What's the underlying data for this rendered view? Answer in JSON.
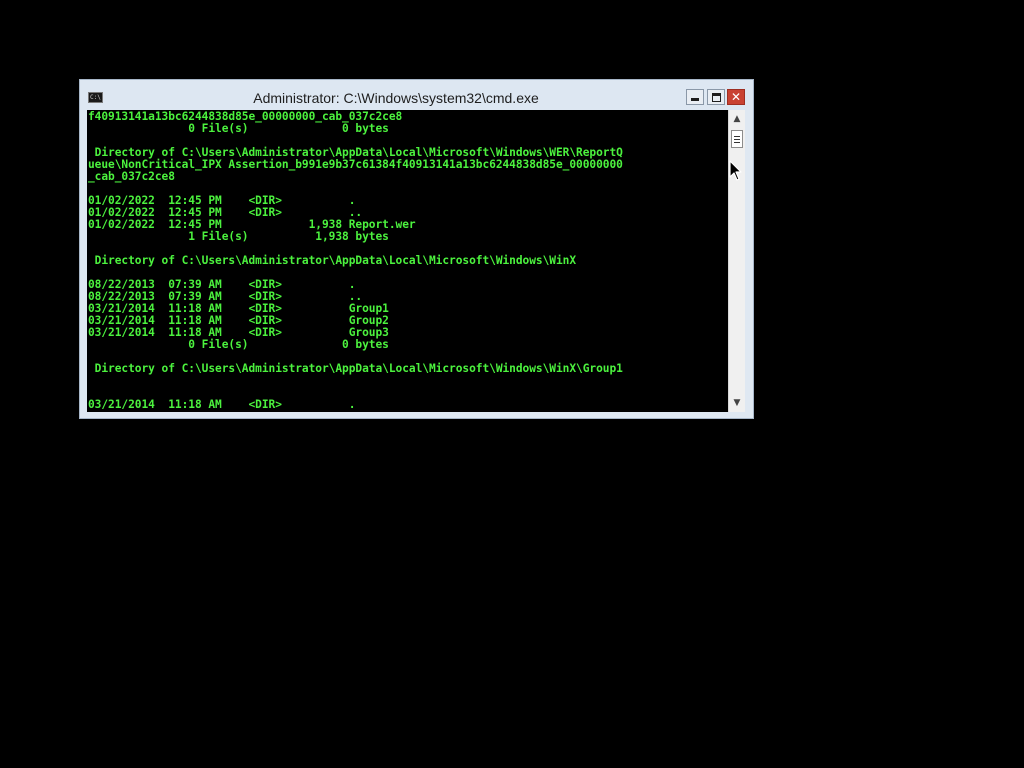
{
  "window": {
    "title": "Administrator: C:\\Windows\\system32\\cmd.exe",
    "icon": "cmd-console-icon",
    "icon_text": "C:\\.",
    "minimize_icon": "minimize-icon",
    "maximize_icon": "maximize-icon",
    "close_icon": "close-icon",
    "close_glyph": "✕"
  },
  "console": {
    "text_color": "#4cf23e",
    "background": "#000000",
    "lines": [
      "f40913141a13bc6244838d85e_00000000_cab_037c2ce8",
      "               0 File(s)              0 bytes",
      "",
      " Directory of C:\\Users\\Administrator\\AppData\\Local\\Microsoft\\Windows\\WER\\ReportQ",
      "ueue\\NonCritical_IPX Assertion_b991e9b37c61384f40913141a13bc6244838d85e_00000000",
      "_cab_037c2ce8",
      "",
      "01/02/2022  12:45 PM    <DIR>          .",
      "01/02/2022  12:45 PM    <DIR>          ..",
      "01/02/2022  12:45 PM             1,938 Report.wer",
      "               1 File(s)          1,938 bytes",
      "",
      " Directory of C:\\Users\\Administrator\\AppData\\Local\\Microsoft\\Windows\\WinX",
      "",
      "08/22/2013  07:39 AM    <DIR>          .",
      "08/22/2013  07:39 AM    <DIR>          ..",
      "03/21/2014  11:18 AM    <DIR>          Group1",
      "03/21/2014  11:18 AM    <DIR>          Group2",
      "03/21/2014  11:18 AM    <DIR>          Group3",
      "               0 File(s)              0 bytes",
      "",
      " Directory of C:\\Users\\Administrator\\AppData\\Local\\Microsoft\\Windows\\WinX\\Group1",
      "",
      "",
      "03/21/2014  11:18 AM    <DIR>          ."
    ]
  },
  "scrollbar": {
    "up_arrow": "▲",
    "down_arrow": "▼",
    "up_icon": "scroll-up-arrow-icon",
    "down_icon": "scroll-down-arrow-icon"
  },
  "pointer": {
    "icon": "mouse-pointer-icon"
  }
}
